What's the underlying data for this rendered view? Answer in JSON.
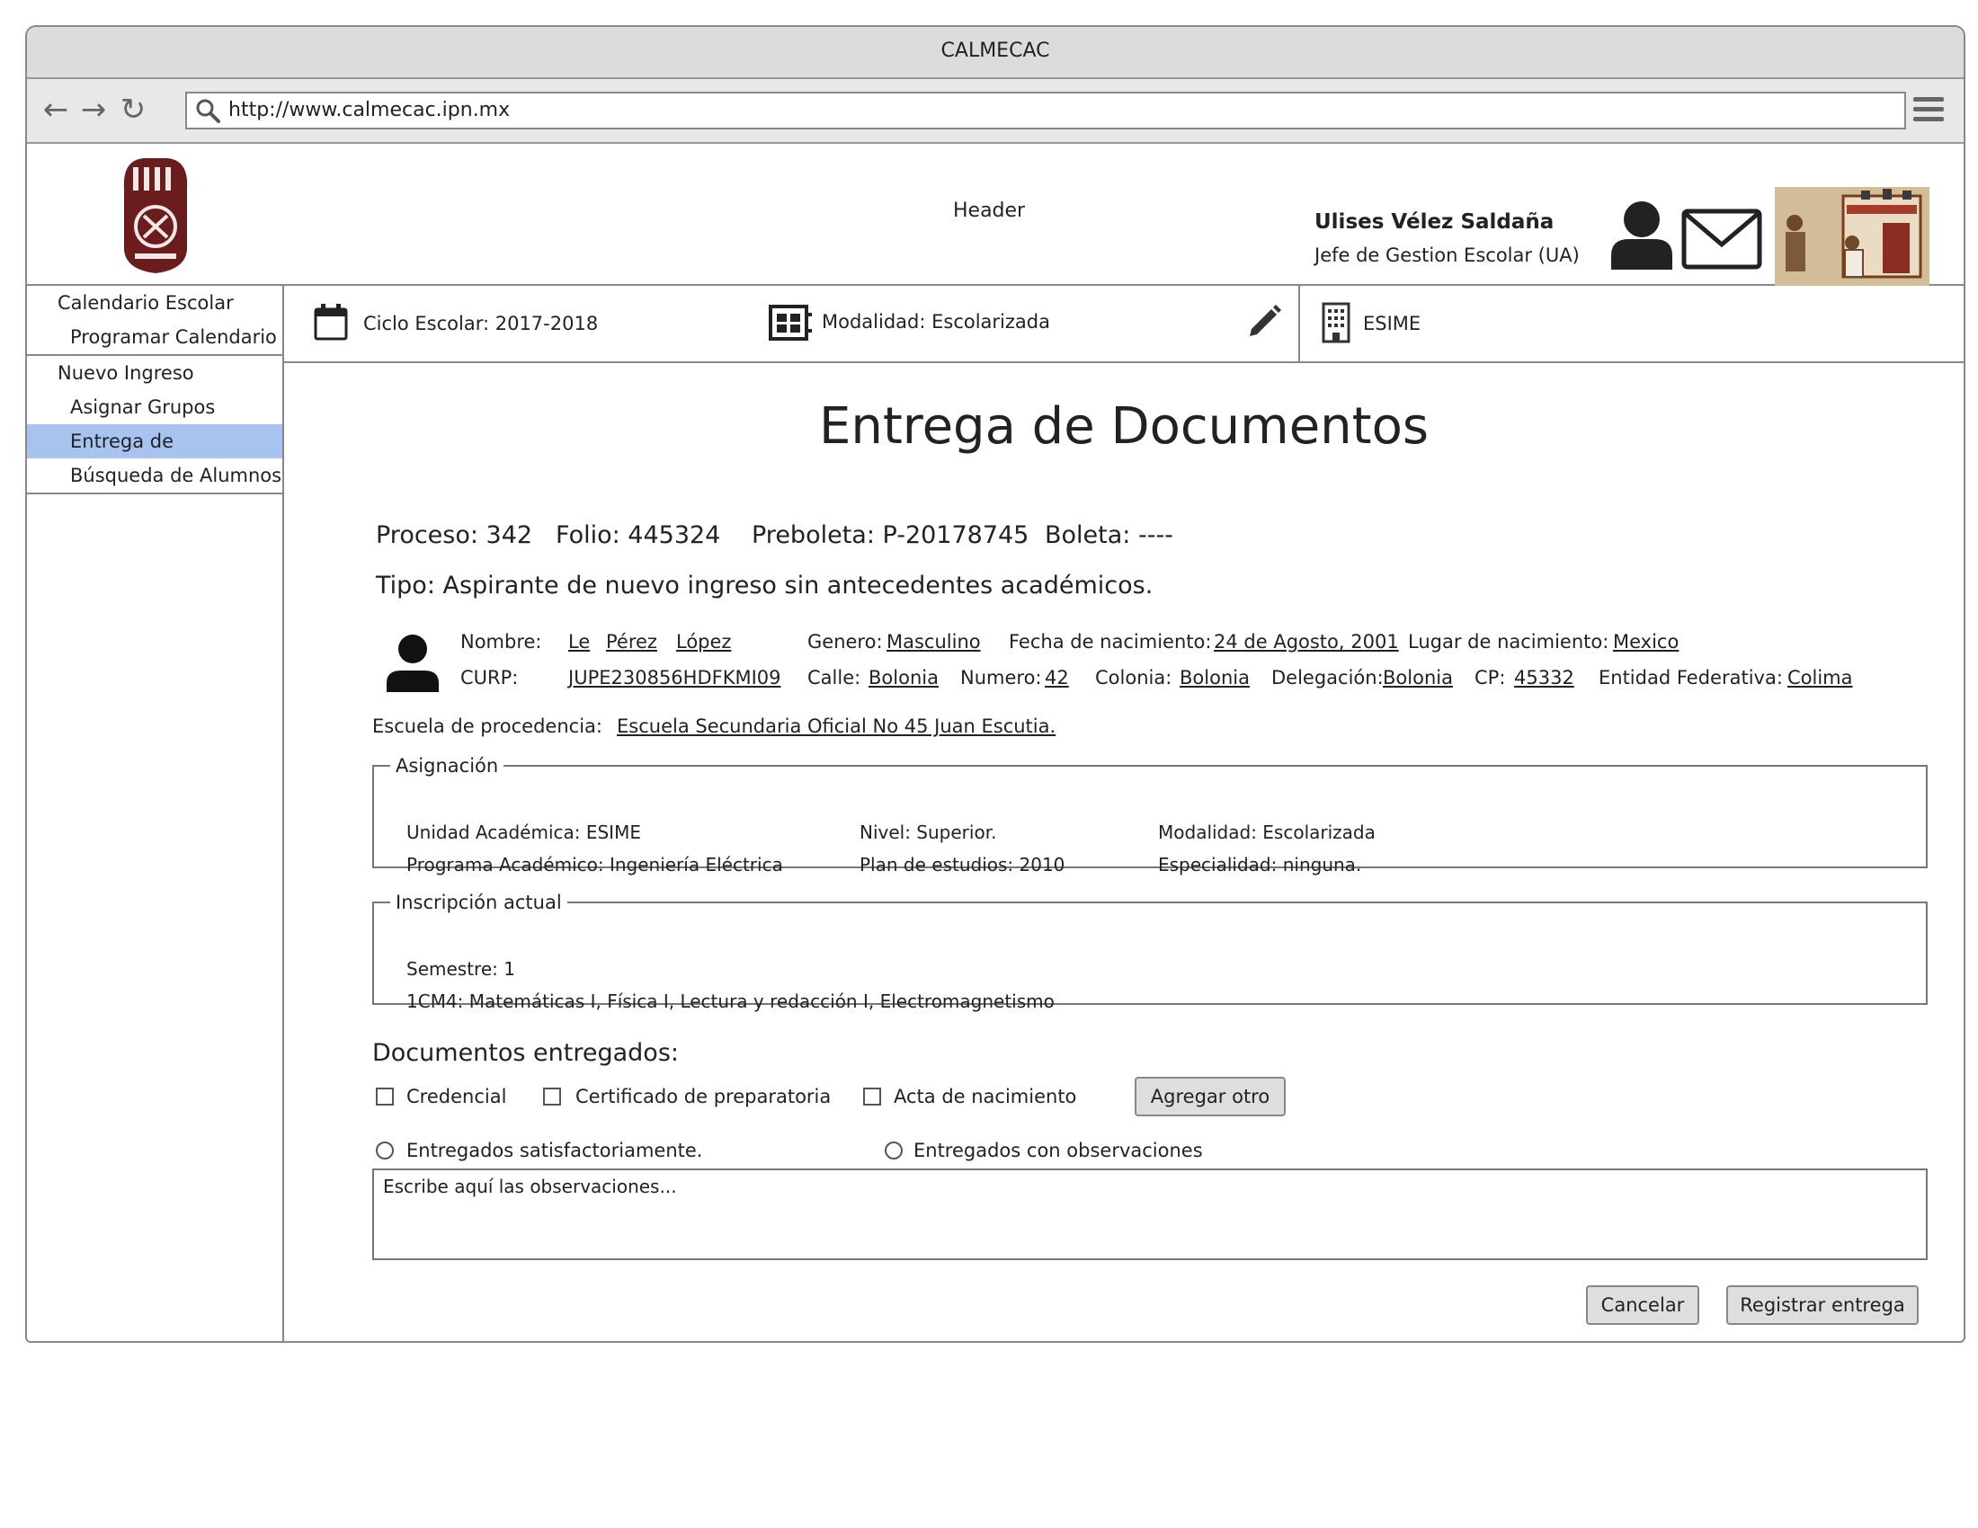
{
  "window": {
    "title": "CALMECAC"
  },
  "browser": {
    "url": "http://www.calmecac.ipn.mx"
  },
  "header": {
    "label": "Header",
    "user_name": "Ulises Vélez Saldaña",
    "user_role": "Jefe de Gestion Escolar (UA)"
  },
  "sidebar": {
    "groups": [
      {
        "label": "Calendario Escolar",
        "items": [
          {
            "label": "Programar Calendario"
          }
        ]
      },
      {
        "label": "Nuevo Ingreso",
        "items": [
          {
            "label": "Asignar Grupos"
          },
          {
            "label": "Entrega de",
            "active": true
          },
          {
            "label": "Búsqueda de Alumnos"
          }
        ]
      }
    ]
  },
  "infobar": {
    "ciclo": "Ciclo Escolar: 2017-2018",
    "modalidad": "Modalidad: Escolarizada",
    "escuela": "ESIME"
  },
  "main": {
    "title": "Entrega de Documentos",
    "summary": {
      "proceso": "Proceso: 342",
      "folio": "Folio: 445324",
      "preboleta": "Preboleta: P-20178745",
      "boleta": "Boleta: ----"
    },
    "tipo": "Tipo: Aspirante de nuevo ingreso sin antecedentes académicos.",
    "student": {
      "nombre_label": "Nombre:",
      "nombre": "Le",
      "ap_paterno": "Pérez",
      "ap_materno": "López",
      "genero_label": "Genero:",
      "genero": "Masculino",
      "fecha_label": "Fecha de nacimiento:",
      "fecha": "24 de Agosto, 2001",
      "lugar_label": "Lugar de nacimiento:",
      "lugar": "Mexico",
      "curp_label": "CURP:",
      "curp": "JUPE230856HDFKMI09",
      "calle_label": "Calle:",
      "calle": "Bolonia",
      "numero_label": "Numero:",
      "numero": "42",
      "colonia_label": "Colonia:",
      "colonia": "Bolonia",
      "delegacion_label": "Delegación:",
      "delegacion": "Bolonia",
      "cp_label": "CP:",
      "cp": "45332",
      "entidad_label": "Entidad Federativa:",
      "entidad": "Colima",
      "escuela_label": "Escuela de procedencia:",
      "escuela": "Escuela Secundaria Oficial No 45 Juan Escutia."
    },
    "asignacion": {
      "legend": "Asignación",
      "unidad": "Unidad Académica: ESIME",
      "programa": "Programa Académico: Ingeniería Eléctrica",
      "nivel": "Nivel: Superior.",
      "plan": "Plan de estudios: 2010",
      "modalidad": "Modalidad: Escolarizada",
      "especialidad": "Especialidad: ninguna."
    },
    "inscripcion": {
      "legend": "Inscripción actual",
      "semestre": "Semestre: 1",
      "grupo": "1CM4: Matemáticas I, Física I, Lectura y redacción I, Electromagnetismo"
    },
    "documentos": {
      "heading": "Documentos entregados:",
      "items": [
        {
          "label": "Credencial",
          "checked": false
        },
        {
          "label": "Certificado de preparatoria",
          "checked": false
        },
        {
          "label": "Acta de nacimiento",
          "checked": false
        }
      ],
      "add_button": "Agregar otro"
    },
    "estado": {
      "ok": "Entregados satisfactoriamente.",
      "obs": "Entregados con observaciones"
    },
    "observaciones_placeholder": "Escribe aquí las observaciones...",
    "buttons": {
      "cancel": "Cancelar",
      "submit": "Registrar entrega"
    }
  }
}
